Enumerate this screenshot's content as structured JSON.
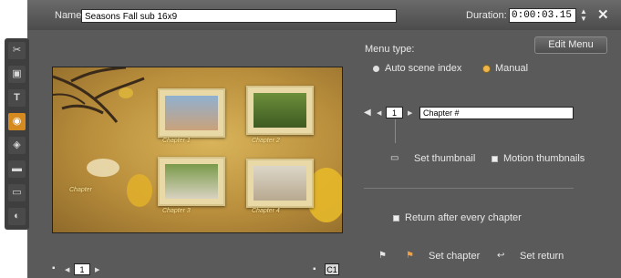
{
  "header": {
    "name_label": "Name:",
    "name_value": "Seasons Fall sub 16x9",
    "duration_label": "Duration:",
    "duration_value": "0:00:03.15"
  },
  "toolbar": {
    "tools": [
      {
        "icon": "scissors-icon",
        "glyph": "✂",
        "active": false
      },
      {
        "icon": "image-icon",
        "glyph": "▣",
        "active": false
      },
      {
        "icon": "text-icon",
        "glyph": "T",
        "active": false
      },
      {
        "icon": "disc-menu-icon",
        "glyph": "◉",
        "active": true
      },
      {
        "icon": "camera-icon",
        "glyph": "◈",
        "active": false
      },
      {
        "icon": "clapper-icon",
        "glyph": "▬",
        "active": false
      },
      {
        "icon": "frame-icon",
        "glyph": "▭",
        "active": false
      },
      {
        "icon": "audio-icon",
        "glyph": "◐",
        "active": false
      }
    ]
  },
  "preview": {
    "captions": [
      "Chapter 1",
      "Chapter 2",
      "Chapter 3",
      "Chapter 4"
    ],
    "left_caption": "Chapter"
  },
  "menu": {
    "type_label": "Menu type:",
    "edit_menu_label": "Edit Menu",
    "options": [
      {
        "label": "Auto scene index",
        "selected": false
      },
      {
        "label": "Manual",
        "selected": true
      }
    ],
    "chapter_number": "1",
    "chapter_name": "Chapter #",
    "set_thumbnail_label": "Set thumbnail",
    "motion_thumbnails_label": "Motion thumbnails",
    "return_after_label": "Return after every chapter",
    "set_chapter_label": "Set chapter",
    "set_return_label": "Set return"
  },
  "footer": {
    "page_number": "1",
    "badge": "C1"
  },
  "colors": {
    "panel_bg": "#5a5a5a",
    "active_tool": "#d48a1e",
    "selected_radio": "#f0b64a"
  }
}
